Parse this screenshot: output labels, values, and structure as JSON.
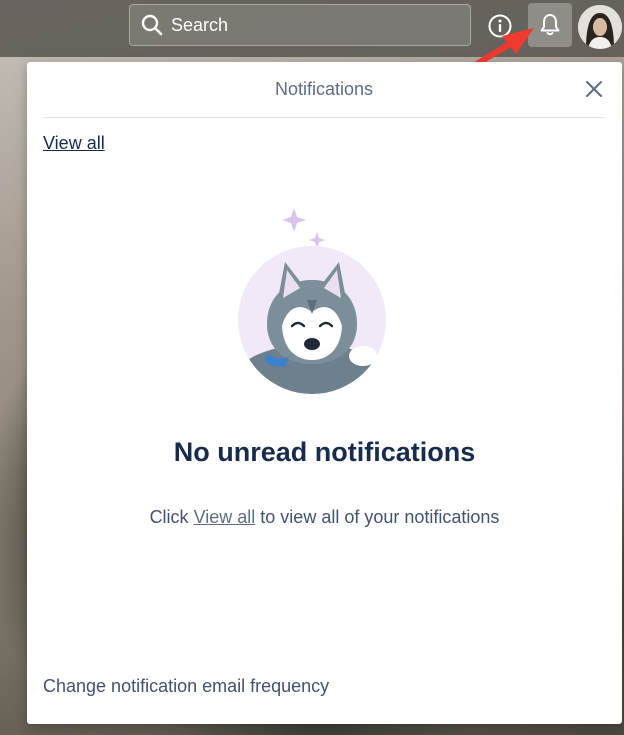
{
  "header": {
    "search_placeholder": "Search",
    "search_icon": "search-icon",
    "info_icon": "info-icon",
    "notifications_icon": "bell-icon",
    "avatar": "user-avatar"
  },
  "notifications": {
    "title": "Notifications",
    "close_icon": "close-icon",
    "view_all_label": "View all",
    "empty_title": "No unread notifications",
    "empty_prefix": "Click",
    "empty_link": "View all",
    "empty_suffix": "to view all of your notifications",
    "email_frequency_label": "Change notification email frequency",
    "illustration": "sleeping-husky-illustration"
  },
  "colors": {
    "accent_arrow": "#f03a2f",
    "panel_text": "#172b4d",
    "muted_text": "#5e6c84"
  }
}
